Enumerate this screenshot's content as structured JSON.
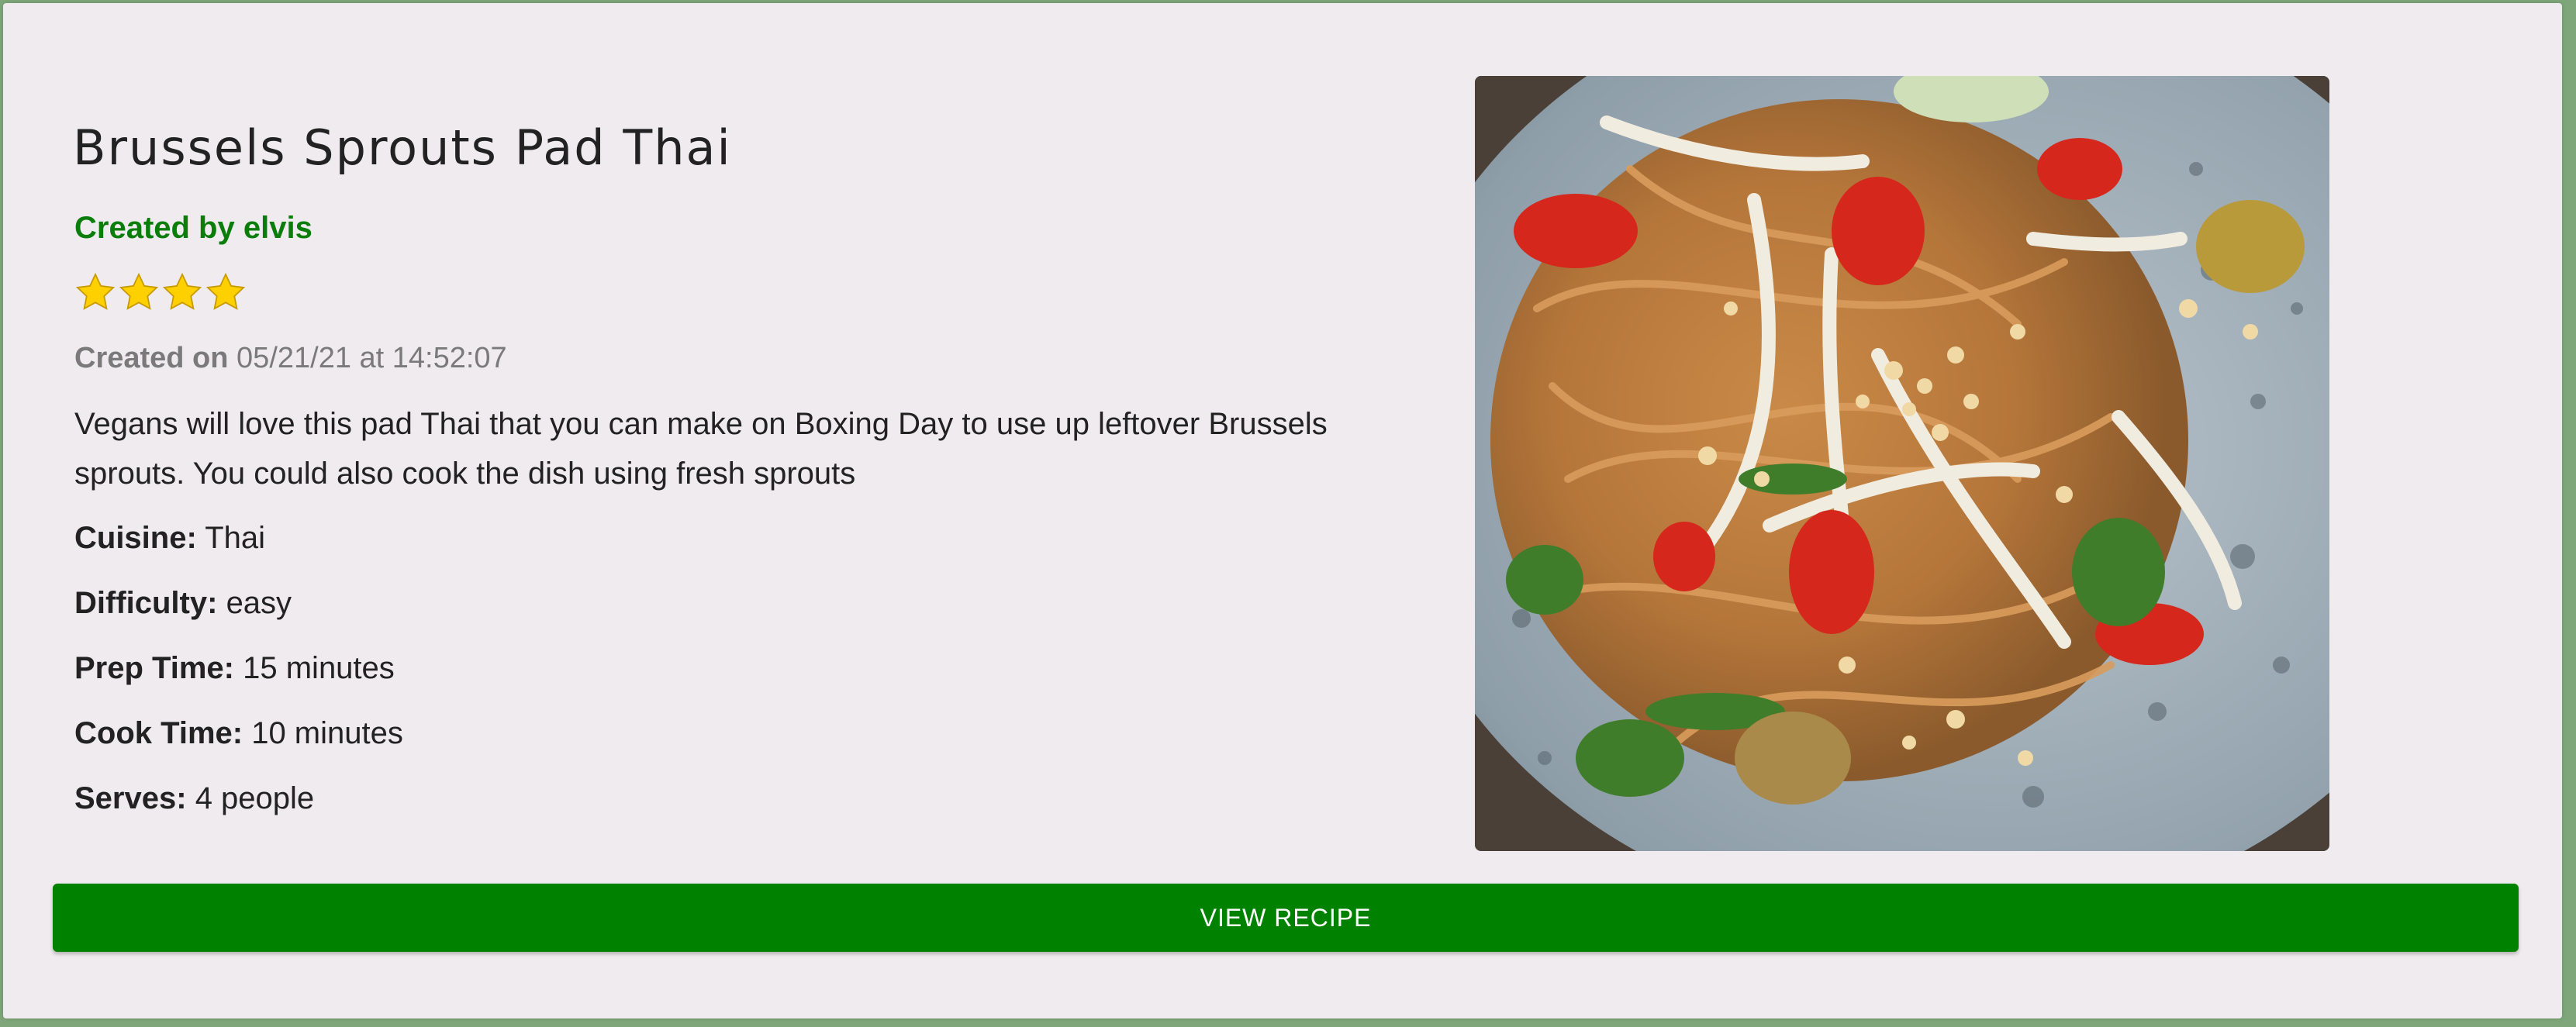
{
  "recipe": {
    "title": "Brussels Sprouts Pad Thai",
    "author": "Created by elvis",
    "rating": 4,
    "created_label": "Created on",
    "created_value": "05/21/21 at 14:52:07",
    "description": "Vegans will love this pad Thai that you can make on Boxing Day to use up leftover Brussels sprouts. You could also cook the dish using fresh sprouts",
    "details": [
      {
        "label": "Cuisine:",
        "value": "Thai"
      },
      {
        "label": "Difficulty:",
        "value": "easy"
      },
      {
        "label": "Prep Time:",
        "value": "15 minutes"
      },
      {
        "label": "Cook Time:",
        "value": "10 minutes"
      },
      {
        "label": "Serves:",
        "value": "4 people"
      }
    ],
    "image_subject": "pad-thai-photo"
  },
  "actions": {
    "view_recipe_label": "VIEW RECIPE"
  },
  "colors": {
    "accent": "#008200",
    "author": "#0b7d0b",
    "card_bg": "#f0ebef",
    "star": "#ffd000"
  }
}
